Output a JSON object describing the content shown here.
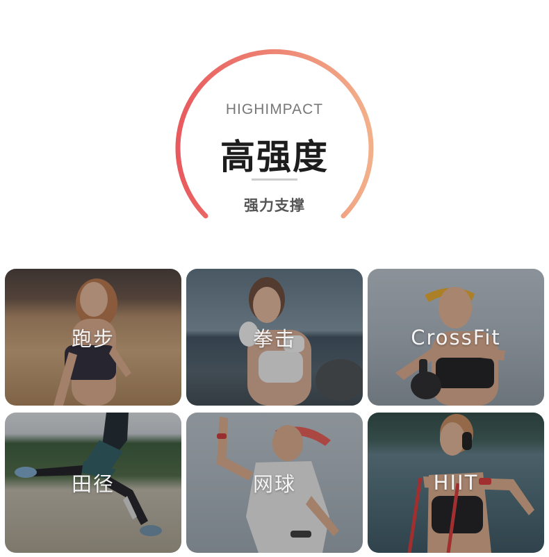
{
  "hero": {
    "eyebrow": "HIGHIMPACT",
    "title": "高强度",
    "subtitle": "强力支撑",
    "arc_colors": [
      "#e85a5e",
      "#f2b08a"
    ]
  },
  "categories": [
    {
      "label": "跑步"
    },
    {
      "label": "拳击"
    },
    {
      "label": "CrossFit"
    },
    {
      "label": "田径"
    },
    {
      "label": "网球"
    },
    {
      "label": "HIIT"
    }
  ]
}
